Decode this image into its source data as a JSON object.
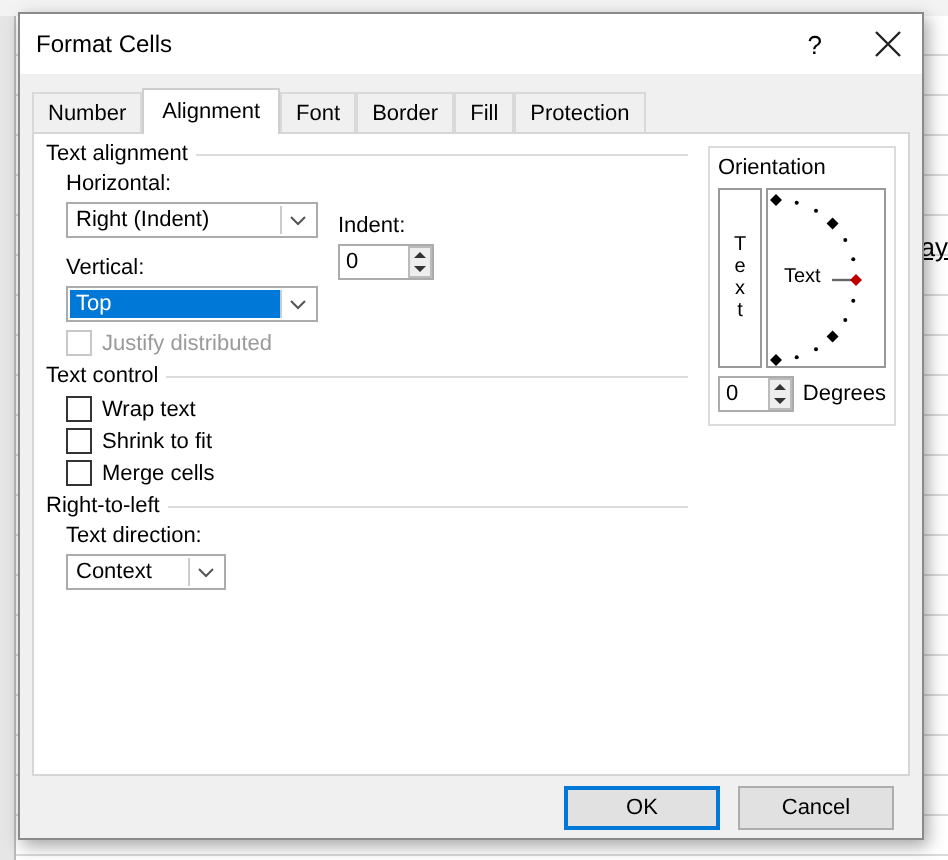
{
  "background": {
    "cell_text": "ay"
  },
  "window": {
    "title": "Format Cells",
    "help": "?"
  },
  "tabs": [
    {
      "label": "Number",
      "selected": false
    },
    {
      "label": "Alignment",
      "selected": true
    },
    {
      "label": "Font",
      "selected": false
    },
    {
      "label": "Border",
      "selected": false
    },
    {
      "label": "Fill",
      "selected": false
    },
    {
      "label": "Protection",
      "selected": false
    }
  ],
  "text_alignment": {
    "heading": "Text alignment",
    "horizontal": {
      "label": "Horizontal:",
      "value": "Right (Indent)",
      "focused": false
    },
    "indent": {
      "label": "Indent:",
      "value": "0"
    },
    "vertical": {
      "label": "Vertical:",
      "value": "Top",
      "focused": true
    },
    "justify_distributed": {
      "label": "Justify distributed",
      "checked": false,
      "disabled": true
    }
  },
  "text_control": {
    "heading": "Text control",
    "options": [
      {
        "label": "Wrap text",
        "checked": false,
        "disabled": false
      },
      {
        "label": "Shrink to fit",
        "checked": false,
        "disabled": false
      },
      {
        "label": "Merge cells",
        "checked": false,
        "disabled": false
      }
    ]
  },
  "right_to_left": {
    "heading": "Right-to-left",
    "text_direction": {
      "label": "Text direction:",
      "value": "Context",
      "focused": false
    }
  },
  "orientation": {
    "heading": "Orientation",
    "vertical_text": "Text",
    "dial_text": "Text",
    "degrees": {
      "value": "0",
      "label": "Degrees"
    }
  },
  "buttons": [
    {
      "label": "OK",
      "default": true
    },
    {
      "label": "Cancel",
      "default": false
    }
  ]
}
